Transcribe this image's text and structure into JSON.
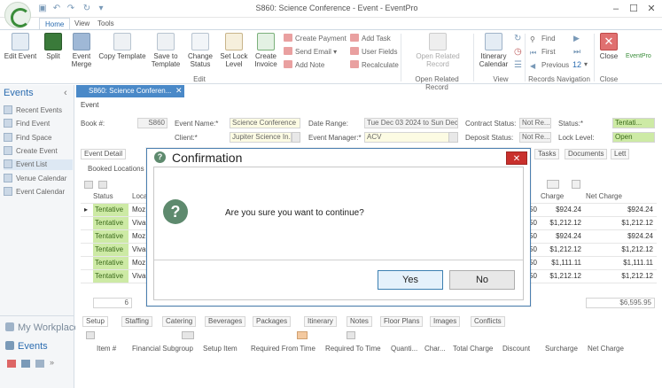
{
  "window": {
    "title": "S860: Science Conference - Event - EventPro"
  },
  "ribbon": {
    "tabs": [
      "Home",
      "View",
      "Tools"
    ],
    "buttons": {
      "edit_event": "Edit Event",
      "split": "Split",
      "event_merge": "Event Merge",
      "copy_template": "Copy Template",
      "save_to_template": "Save to Template",
      "change_status": "Change Status",
      "set_lock_level": "Set Lock Level",
      "create_invoice": "Create Invoice",
      "create_payment": "Create Payment",
      "send_email": "Send Email",
      "add_note": "Add Note",
      "add_task": "Add Task",
      "user_fields": "User Fields",
      "recalculate": "Recalculate",
      "open_related_record": "Open Related Record",
      "itinerary_calendar": "Itinerary Calendar",
      "find": "Find",
      "first": "First",
      "previous": "Previous",
      "close": "Close",
      "page_number": "12"
    },
    "groups": {
      "edit": "Edit",
      "open_related_record": "Open Related Record",
      "view": "View",
      "records_navigation": "Records Navigation",
      "close": "Close"
    },
    "brand": "EventPro"
  },
  "nav": {
    "title": "Events",
    "items": [
      "Recent Events",
      "Find Event",
      "Find Space",
      "Create Event",
      "Event List",
      "Venue Calendar",
      "Event Calendar"
    ],
    "bottom": [
      "My Workplace",
      "Events"
    ]
  },
  "doc_tab": {
    "label": "S860: Science Conferen..."
  },
  "form": {
    "section": "Event",
    "book_no_label": "Book #:",
    "book_no": "S860",
    "event_name_label": "Event Name:*",
    "event_name": "Science Conference",
    "client_label": "Client:*",
    "client": "Jupiter Science In...",
    "date_range_label": "Date Range:",
    "date_range": "Tue Dec 03 2024 to Sun Dec 0",
    "event_manager_label": "Event Manager:*",
    "event_manager": "ACV",
    "contract_status_label": "Contract Status:",
    "contract_status": "Not Re...",
    "deposit_status_label": "Deposit Status:",
    "deposit_status": "Not Re...",
    "status_label": "Status:*",
    "status": "Tentati...",
    "lock_level_label": "Lock Level:",
    "lock_level": "Open"
  },
  "subtabs": {
    "event_detail": "Event Detail",
    "tasks": "Tasks",
    "documents": "Documents",
    "letters": "Lett"
  },
  "booked_locations": {
    "title": "Booked Locations",
    "col_status": "Status",
    "col_location": "Loca",
    "col_charge": "Charge",
    "col_net_charge": "Net Charge",
    "rows": [
      {
        "status": "Tentative",
        "loc": "Moz",
        "qty": "50",
        "charge": "$924.24",
        "net": "$924.24"
      },
      {
        "status": "Tentative",
        "loc": "Viva",
        "qty": "50",
        "charge": "$1,212.12",
        "net": "$1,212.12"
      },
      {
        "status": "Tentative",
        "loc": "Moz",
        "qty": "50",
        "charge": "$924.24",
        "net": "$924.24"
      },
      {
        "status": "Tentative",
        "loc": "Viva",
        "qty": "50",
        "charge": "$1,212.12",
        "net": "$1,212.12"
      },
      {
        "status": "Tentative",
        "loc": "Moz",
        "qty": "50",
        "charge": "$1,111.11",
        "net": "$1,111.11"
      },
      {
        "status": "Tentative",
        "loc": "Viva",
        "qty": "50",
        "charge": "$1,212.12",
        "net": "$1,212.12"
      }
    ],
    "count": "6",
    "total": "$6,595.95"
  },
  "bottom_tabs": [
    "Setup",
    "Staffing",
    "Catering",
    "Beverages",
    "Packages",
    "Itinerary",
    "Notes",
    "Floor Plans",
    "Images",
    "Conflicts"
  ],
  "setup_grid": {
    "columns": [
      "Item #",
      "Financial Subgroup",
      "Setup Item",
      "Required From Time",
      "Required To Time",
      "Quanti...",
      "Char...",
      "Total Charge",
      "Discount",
      "Surcharge",
      "Net Charge"
    ]
  },
  "dialog": {
    "title": "Confirmation",
    "message": "Are you sure you want to continue?",
    "yes": "Yes",
    "no": "No"
  },
  "colors": {
    "accent": "#2b6cb0",
    "tentative": "#cdeaa5",
    "close_red": "#c9302c"
  }
}
